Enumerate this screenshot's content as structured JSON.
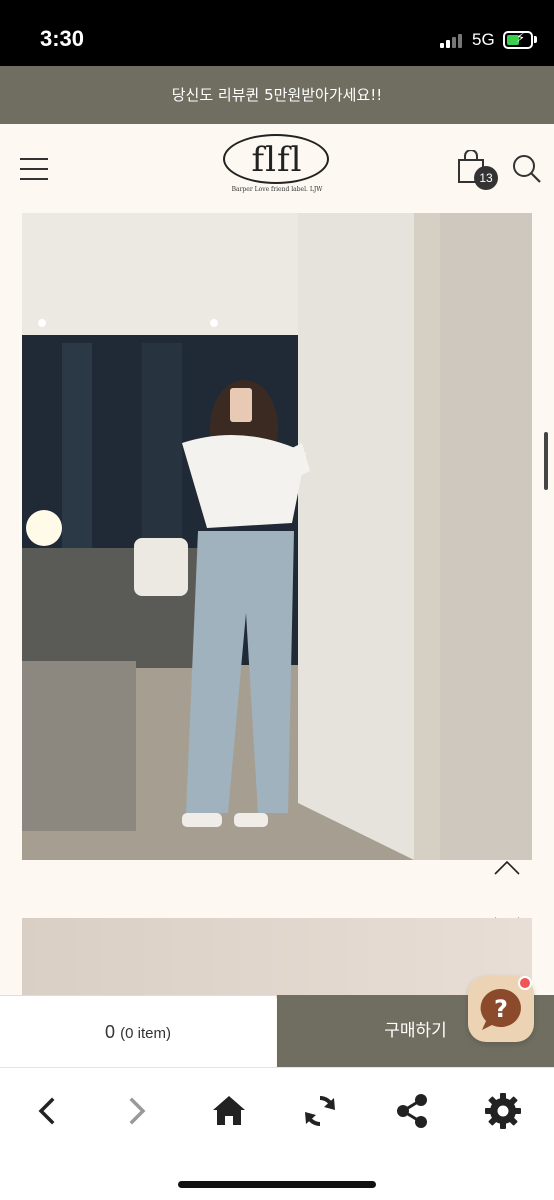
{
  "status_bar": {
    "time": "3:30",
    "network": "5G"
  },
  "promo": {
    "text": "당신도 리뷰퀸 5만원받아가세요!!"
  },
  "header": {
    "logo_text": "flfl",
    "logo_subtitle": "Barper Love friend label. LJW",
    "cart_badge": "13"
  },
  "buy_bar": {
    "count": "0",
    "items_label": "(0 item)",
    "buy_label": "구매하기"
  },
  "colors": {
    "promo_bg": "#6f6e60",
    "page_bg": "#fdf9f2",
    "chat_bg": "#ecd3b4",
    "chat_icon": "#8b4a2b",
    "notification_dot": "#f05558"
  },
  "icons": {
    "menu": "hamburger-icon",
    "cart": "shopping-bag-icon",
    "search": "search-icon",
    "scroll_up": "chevron-up-icon",
    "scroll_down": "chevron-down-icon",
    "chat": "question-chat-icon",
    "back": "arrow-left-icon",
    "forward": "arrow-right-icon",
    "home": "home-icon",
    "refresh": "refresh-icon",
    "share": "share-icon",
    "settings": "gear-icon"
  }
}
